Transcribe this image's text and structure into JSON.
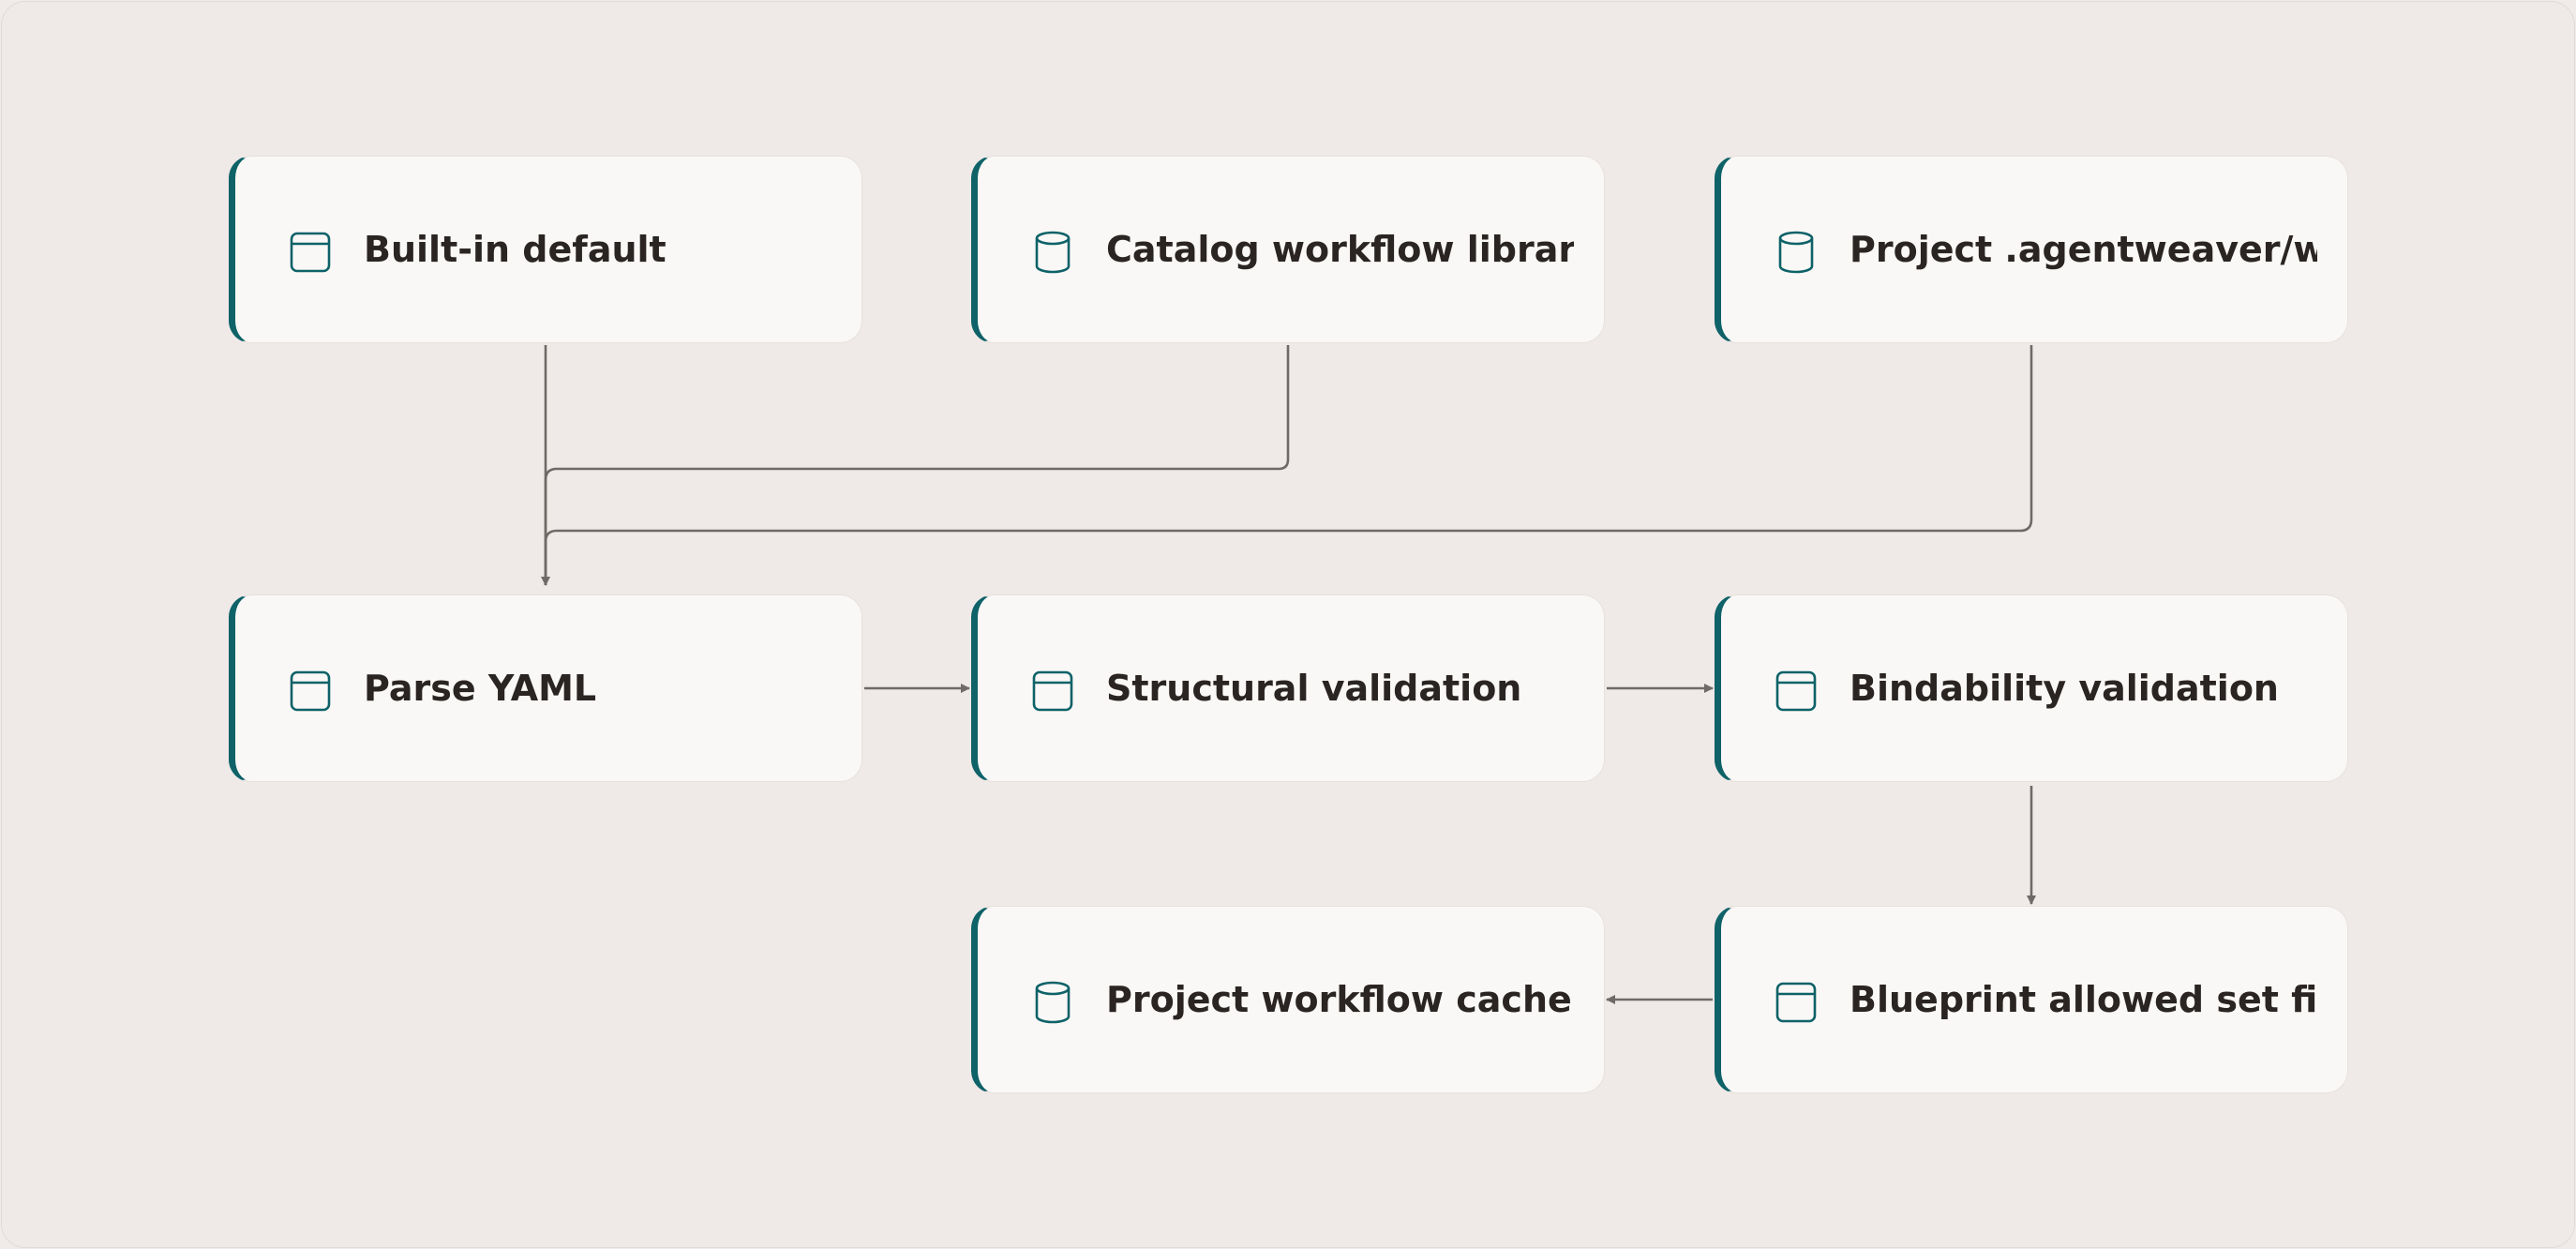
{
  "colors": {
    "background": "#efe9e7",
    "node_fill": "#faf8f6",
    "node_accent": "#0e6268",
    "edge": "#6f6a67",
    "text": "#2a2522"
  },
  "nodes": [
    {
      "id": "builtin",
      "label": "Built-in default",
      "icon": "panel-icon"
    },
    {
      "id": "catalog",
      "label": "Catalog workflow library",
      "icon": "database-icon"
    },
    {
      "id": "project_dir",
      "label": "Project .agentweaver/wor...",
      "icon": "database-icon"
    },
    {
      "id": "parse",
      "label": "Parse YAML",
      "icon": "panel-icon"
    },
    {
      "id": "structural",
      "label": "Structural validation",
      "icon": "panel-icon"
    },
    {
      "id": "bindability",
      "label": "Bindability validation",
      "icon": "panel-icon"
    },
    {
      "id": "cache",
      "label": "Project workflow cache",
      "icon": "database-icon"
    },
    {
      "id": "filter",
      "label": "Blueprint allowed set filter",
      "icon": "panel-icon"
    }
  ],
  "edges": [
    {
      "from": "builtin",
      "to": "parse"
    },
    {
      "from": "catalog",
      "to": "parse"
    },
    {
      "from": "project_dir",
      "to": "parse"
    },
    {
      "from": "parse",
      "to": "structural"
    },
    {
      "from": "structural",
      "to": "bindability"
    },
    {
      "from": "bindability",
      "to": "filter"
    },
    {
      "from": "filter",
      "to": "cache"
    }
  ]
}
